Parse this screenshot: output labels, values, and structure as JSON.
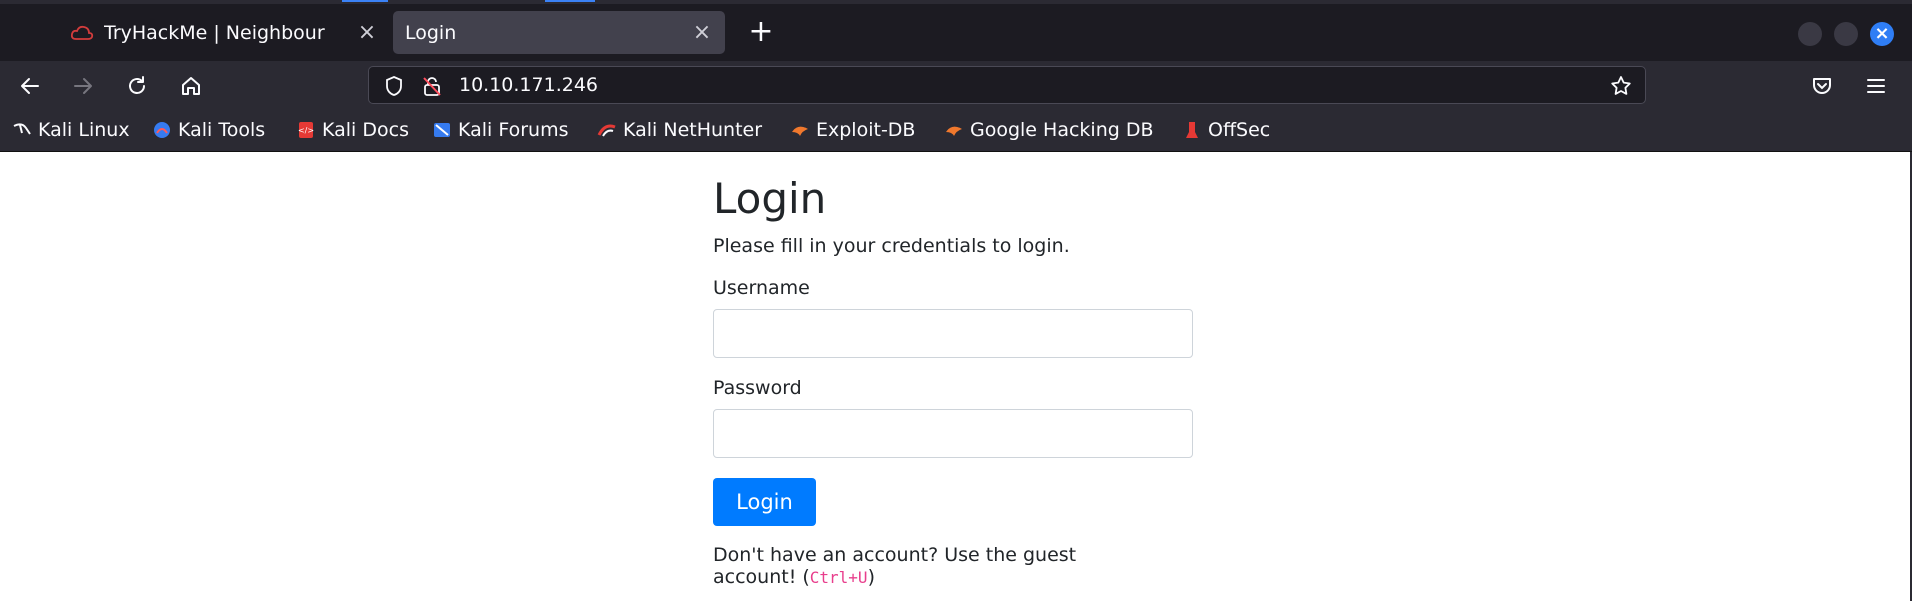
{
  "browser": {
    "tabs": [
      {
        "title": "TryHackMe | Neighbour",
        "active": false,
        "favicon": "tryhackme-cloud-icon"
      },
      {
        "title": "Login",
        "active": true
      }
    ],
    "new_tab": "+",
    "url": "10.10.171.246",
    "bookmarks": [
      {
        "label": "Kali Linux",
        "icon": "kali-dragon-icon"
      },
      {
        "label": "Kali Tools",
        "icon": "kali-tools-icon"
      },
      {
        "label": "Kali Docs",
        "icon": "kali-docs-icon"
      },
      {
        "label": "Kali Forums",
        "icon": "kali-forums-icon"
      },
      {
        "label": "Kali NetHunter",
        "icon": "kali-nethunter-icon"
      },
      {
        "label": "Exploit-DB",
        "icon": "exploit-db-icon"
      },
      {
        "label": "Google Hacking DB",
        "icon": "google-hacking-db-icon"
      },
      {
        "label": "OffSec",
        "icon": "offsec-icon"
      }
    ]
  },
  "page": {
    "title": "Login",
    "subtitle": "Please fill in your credentials to login.",
    "username_label": "Username",
    "username_value": "",
    "password_label": "Password",
    "password_value": "",
    "login_button": "Login",
    "guest_text": "Don't have an account? Use the guest account! (",
    "guest_shortcut": "Ctrl+U",
    "guest_close": ")"
  },
  "colors": {
    "chrome_dark": "#1c1b22",
    "chrome_mid": "#2b2a33",
    "active_tab": "#42414d",
    "primary_button": "#007bff",
    "code_pink": "#e83e8c",
    "window_close": "#2f7ef5"
  }
}
